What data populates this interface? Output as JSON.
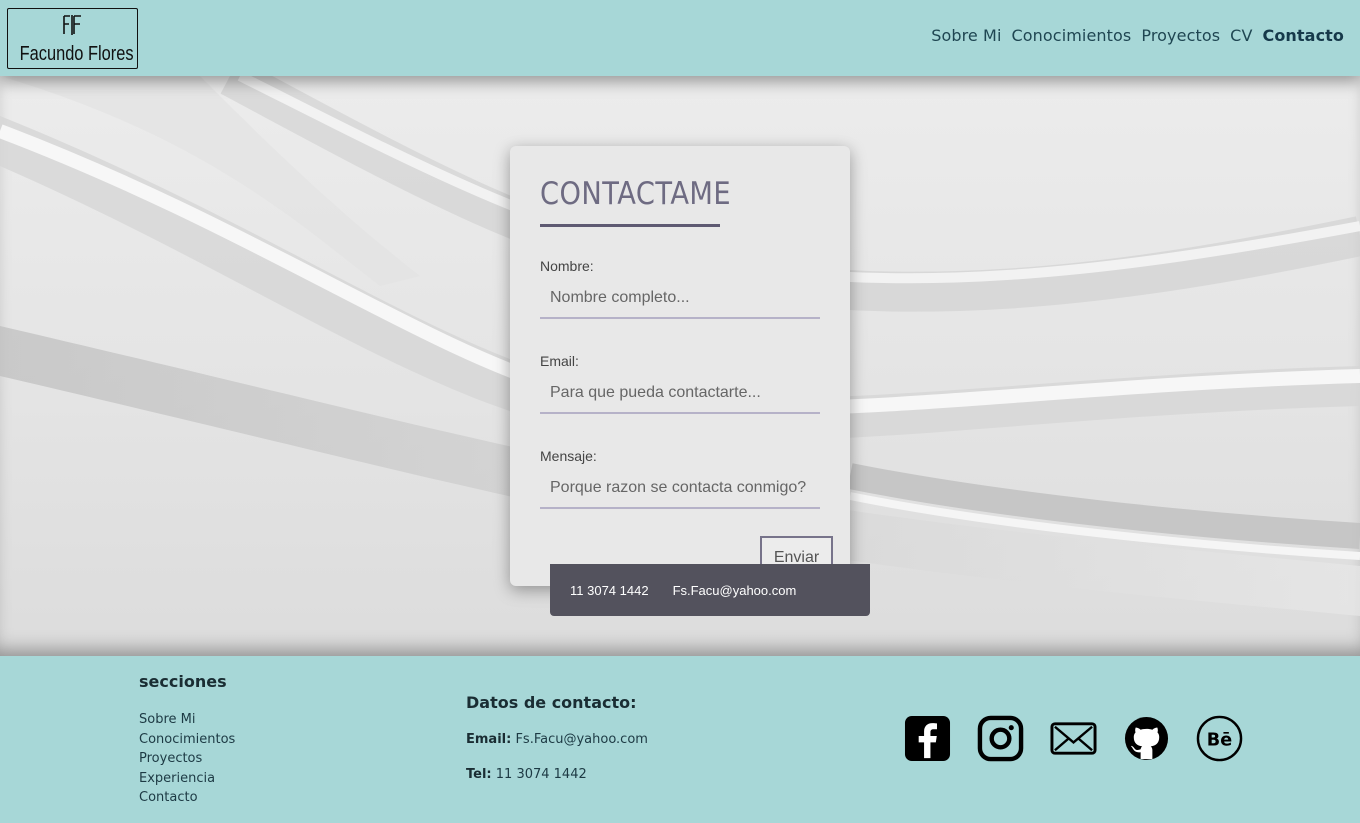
{
  "logo": {
    "mark": "╕F",
    "name": "Facundo Flores"
  },
  "nav": {
    "items": [
      "Sobre Mi",
      "Conocimientos",
      "Proyectos",
      "CV",
      "Contacto"
    ],
    "active": "Contacto"
  },
  "form": {
    "title": "CONTACTAME",
    "nombre_label": "Nombre:",
    "nombre_placeholder": "Nombre completo...",
    "email_label": "Email:",
    "email_placeholder": "Para que pueda contactarte...",
    "mensaje_label": "Mensaje:",
    "mensaje_placeholder": "Porque razon se contacta conmigo?",
    "submit_label": "Enviar"
  },
  "contact_bar": {
    "phone": "11 3074 1442",
    "email": "Fs.Facu@yahoo.com"
  },
  "footer": {
    "sections_title": "secciones",
    "links": [
      "Sobre Mi",
      "Conocimientos",
      "Proyectos",
      "Experiencia",
      "Contacto"
    ],
    "contact_title": "Datos de contacto:",
    "email_label": "Email:",
    "email_value": "Fs.Facu@yahoo.com",
    "tel_label": "Tel:",
    "tel_value": "11 3074 1442",
    "socials": [
      "facebook-icon",
      "instagram-icon",
      "mail-icon",
      "github-icon",
      "behance-icon"
    ]
  },
  "colors": {
    "header_bg": "#a7d7d7",
    "card_title": "#6e6b82",
    "info_bar": "#53525d",
    "nav_text": "#1f4652"
  }
}
